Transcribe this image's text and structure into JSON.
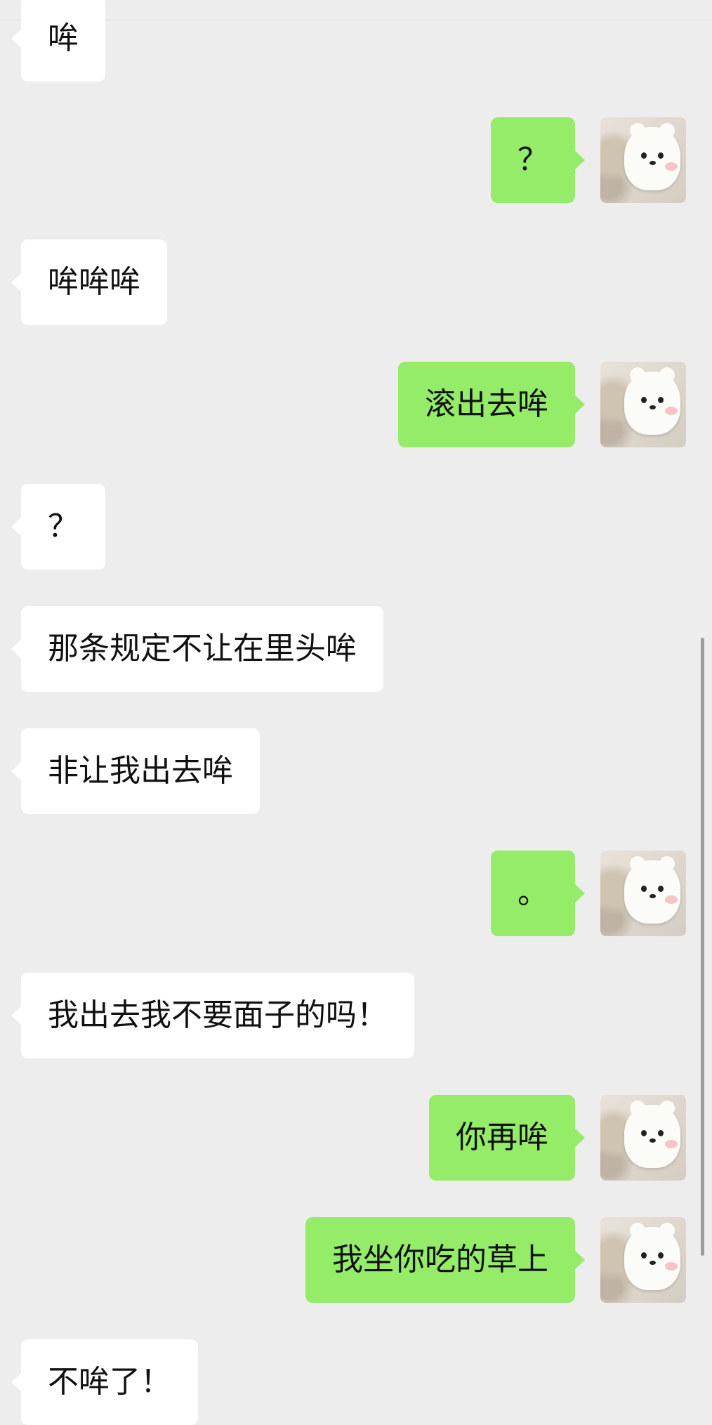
{
  "messages": [
    {
      "side": "left",
      "text": "哞"
    },
    {
      "side": "right",
      "text": "？"
    },
    {
      "side": "left",
      "text": "哞哞哞"
    },
    {
      "side": "right",
      "text": "滚出去哞"
    },
    {
      "side": "left",
      "text": "？"
    },
    {
      "side": "left",
      "text": "那条规定不让在里头哞"
    },
    {
      "side": "left",
      "text": "非让我出去哞"
    },
    {
      "side": "right",
      "text": "。"
    },
    {
      "side": "left",
      "text": "我出去我不要面子的吗！"
    },
    {
      "side": "right",
      "text": "你再哞"
    },
    {
      "side": "right",
      "text": "我坐你吃的草上"
    },
    {
      "side": "left",
      "text": "不哞了！"
    }
  ],
  "colors": {
    "background": "#ededed",
    "incoming_bubble": "#ffffff",
    "outgoing_bubble": "#95ec69"
  },
  "icons": {
    "avatar": "white-bear-plush-avatar"
  }
}
